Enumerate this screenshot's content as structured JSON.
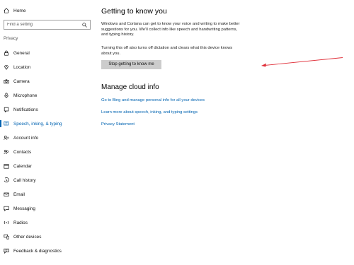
{
  "sidebar": {
    "home_label": "Home",
    "search_placeholder": "Find a setting",
    "section_label": "Privacy",
    "items": [
      {
        "label": "General",
        "icon": "lock-icon"
      },
      {
        "label": "Location",
        "icon": "location-icon"
      },
      {
        "label": "Camera",
        "icon": "camera-icon"
      },
      {
        "label": "Microphone",
        "icon": "microphone-icon"
      },
      {
        "label": "Notifications",
        "icon": "notifications-icon"
      },
      {
        "label": "Speech, inking, & typing",
        "icon": "speech-inking-icon",
        "active": true
      },
      {
        "label": "Account info",
        "icon": "account-info-icon"
      },
      {
        "label": "Contacts",
        "icon": "contacts-icon"
      },
      {
        "label": "Calendar",
        "icon": "calendar-icon"
      },
      {
        "label": "Call history",
        "icon": "call-history-icon"
      },
      {
        "label": "Email",
        "icon": "email-icon"
      },
      {
        "label": "Messaging",
        "icon": "messaging-icon"
      },
      {
        "label": "Radios",
        "icon": "radios-icon"
      },
      {
        "label": "Other devices",
        "icon": "other-devices-icon"
      },
      {
        "label": "Feedback & diagnostics",
        "icon": "feedback-icon"
      }
    ]
  },
  "main": {
    "title": "Getting to know you",
    "description": "Windows and Cortana can get to know your voice and writing to make better suggestions for you. We'll collect info like speech and handwriting patterns, and typing history.",
    "warning": "Turning this off also turns off dictation and clears what this device knows about you.",
    "stop_button_label": "Stop getting to know me",
    "cloud_title": "Manage cloud info",
    "links": [
      "Go to Bing and manage personal info for all your devices",
      "Learn more about speech, inking, and typing settings",
      "Privacy Statement"
    ]
  },
  "colors": {
    "accent": "#0063b1",
    "button_bg": "#cccccc",
    "annotation_arrow": "#e0303a"
  }
}
